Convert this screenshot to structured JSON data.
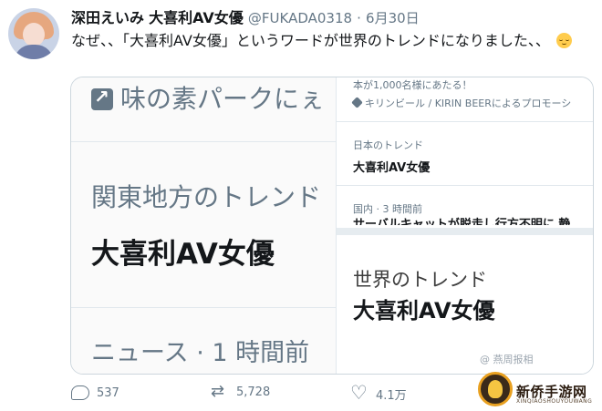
{
  "tweet": {
    "name": "深田えいみ",
    "title_tag": "大喜利AV女優",
    "handle": "@FUKADA0318",
    "separator": "·",
    "date": "6月30日",
    "text": "なぜ、、「大喜利AV女優」というワードが世界のトレンドになりました、、",
    "emoji": "relieved-face-emoji"
  },
  "screenshot_left": {
    "promo": "味の素パークにぇ",
    "trend_label": "関東地方のトレンド",
    "trend_name": "大喜利AV女優",
    "news_meta": "ニュース · 1 時間前"
  },
  "screenshot_right": {
    "top_cut": "本が1,000名様にあたる！",
    "promo": "キリンビール / KIRIN BEERによるプロモーシ",
    "trend1_label": "日本のトレンド",
    "trend1_name": "大喜利AV女優",
    "news_meta": "国内 · 3 時間前",
    "news_cut": "サーバルキャットが脱走し行方不明に 静",
    "trend2_label": "世界のトレンド",
    "trend2_name": "大喜利AV女優"
  },
  "actions": {
    "reply_count": "537",
    "retweet_count": "5,728",
    "like_count": "4.1万"
  },
  "watermark": {
    "caption": "@ 燕周报相",
    "logo_text": "新侨手游网",
    "logo_sub": "XINQIAOSHOUYOUWANG"
  }
}
